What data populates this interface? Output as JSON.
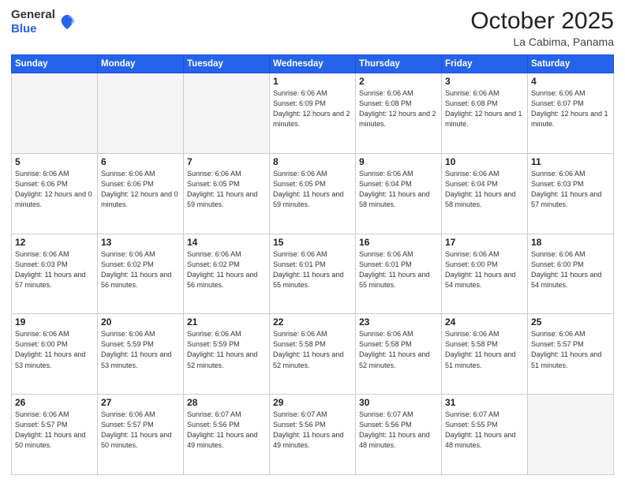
{
  "header": {
    "logo_general": "General",
    "logo_blue": "Blue",
    "month": "October 2025",
    "location": "La Cabima, Panama"
  },
  "weekdays": [
    "Sunday",
    "Monday",
    "Tuesday",
    "Wednesday",
    "Thursday",
    "Friday",
    "Saturday"
  ],
  "weeks": [
    [
      {
        "day": "",
        "info": ""
      },
      {
        "day": "",
        "info": ""
      },
      {
        "day": "",
        "info": ""
      },
      {
        "day": "1",
        "info": "Sunrise: 6:06 AM\nSunset: 6:09 PM\nDaylight: 12 hours and 2 minutes."
      },
      {
        "day": "2",
        "info": "Sunrise: 6:06 AM\nSunset: 6:08 PM\nDaylight: 12 hours and 2 minutes."
      },
      {
        "day": "3",
        "info": "Sunrise: 6:06 AM\nSunset: 6:08 PM\nDaylight: 12 hours and 1 minute."
      },
      {
        "day": "4",
        "info": "Sunrise: 6:06 AM\nSunset: 6:07 PM\nDaylight: 12 hours and 1 minute."
      }
    ],
    [
      {
        "day": "5",
        "info": "Sunrise: 6:06 AM\nSunset: 6:06 PM\nDaylight: 12 hours and 0 minutes."
      },
      {
        "day": "6",
        "info": "Sunrise: 6:06 AM\nSunset: 6:06 PM\nDaylight: 12 hours and 0 minutes."
      },
      {
        "day": "7",
        "info": "Sunrise: 6:06 AM\nSunset: 6:05 PM\nDaylight: 11 hours and 59 minutes."
      },
      {
        "day": "8",
        "info": "Sunrise: 6:06 AM\nSunset: 6:05 PM\nDaylight: 11 hours and 59 minutes."
      },
      {
        "day": "9",
        "info": "Sunrise: 6:06 AM\nSunset: 6:04 PM\nDaylight: 11 hours and 58 minutes."
      },
      {
        "day": "10",
        "info": "Sunrise: 6:06 AM\nSunset: 6:04 PM\nDaylight: 11 hours and 58 minutes."
      },
      {
        "day": "11",
        "info": "Sunrise: 6:06 AM\nSunset: 6:03 PM\nDaylight: 11 hours and 57 minutes."
      }
    ],
    [
      {
        "day": "12",
        "info": "Sunrise: 6:06 AM\nSunset: 6:03 PM\nDaylight: 11 hours and 57 minutes."
      },
      {
        "day": "13",
        "info": "Sunrise: 6:06 AM\nSunset: 6:02 PM\nDaylight: 11 hours and 56 minutes."
      },
      {
        "day": "14",
        "info": "Sunrise: 6:06 AM\nSunset: 6:02 PM\nDaylight: 11 hours and 56 minutes."
      },
      {
        "day": "15",
        "info": "Sunrise: 6:06 AM\nSunset: 6:01 PM\nDaylight: 11 hours and 55 minutes."
      },
      {
        "day": "16",
        "info": "Sunrise: 6:06 AM\nSunset: 6:01 PM\nDaylight: 11 hours and 55 minutes."
      },
      {
        "day": "17",
        "info": "Sunrise: 6:06 AM\nSunset: 6:00 PM\nDaylight: 11 hours and 54 minutes."
      },
      {
        "day": "18",
        "info": "Sunrise: 6:06 AM\nSunset: 6:00 PM\nDaylight: 11 hours and 54 minutes."
      }
    ],
    [
      {
        "day": "19",
        "info": "Sunrise: 6:06 AM\nSunset: 6:00 PM\nDaylight: 11 hours and 53 minutes."
      },
      {
        "day": "20",
        "info": "Sunrise: 6:06 AM\nSunset: 5:59 PM\nDaylight: 11 hours and 53 minutes."
      },
      {
        "day": "21",
        "info": "Sunrise: 6:06 AM\nSunset: 5:59 PM\nDaylight: 11 hours and 52 minutes."
      },
      {
        "day": "22",
        "info": "Sunrise: 6:06 AM\nSunset: 5:58 PM\nDaylight: 11 hours and 52 minutes."
      },
      {
        "day": "23",
        "info": "Sunrise: 6:06 AM\nSunset: 5:58 PM\nDaylight: 11 hours and 52 minutes."
      },
      {
        "day": "24",
        "info": "Sunrise: 6:06 AM\nSunset: 5:58 PM\nDaylight: 11 hours and 51 minutes."
      },
      {
        "day": "25",
        "info": "Sunrise: 6:06 AM\nSunset: 5:57 PM\nDaylight: 11 hours and 51 minutes."
      }
    ],
    [
      {
        "day": "26",
        "info": "Sunrise: 6:06 AM\nSunset: 5:57 PM\nDaylight: 11 hours and 50 minutes."
      },
      {
        "day": "27",
        "info": "Sunrise: 6:06 AM\nSunset: 5:57 PM\nDaylight: 11 hours and 50 minutes."
      },
      {
        "day": "28",
        "info": "Sunrise: 6:07 AM\nSunset: 5:56 PM\nDaylight: 11 hours and 49 minutes."
      },
      {
        "day": "29",
        "info": "Sunrise: 6:07 AM\nSunset: 5:56 PM\nDaylight: 11 hours and 49 minutes."
      },
      {
        "day": "30",
        "info": "Sunrise: 6:07 AM\nSunset: 5:56 PM\nDaylight: 11 hours and 48 minutes."
      },
      {
        "day": "31",
        "info": "Sunrise: 6:07 AM\nSunset: 5:55 PM\nDaylight: 11 hours and 48 minutes."
      },
      {
        "day": "",
        "info": ""
      }
    ]
  ]
}
